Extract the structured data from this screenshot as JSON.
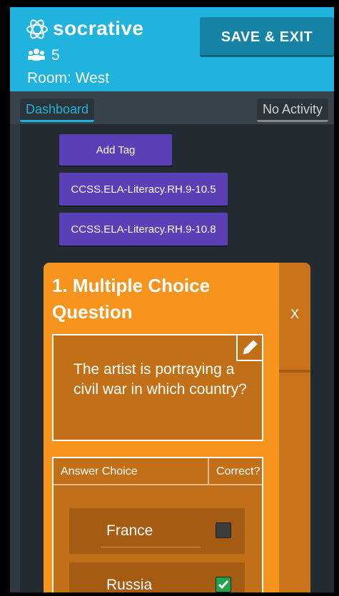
{
  "header": {
    "brand": "socrative",
    "logo_icon": "atom-logo-icon",
    "users_icon": "users-icon",
    "student_count": "5",
    "room": "Room: West",
    "save_exit_label": "SAVE & EXIT",
    "brand_color": "#1fb3dd"
  },
  "subnav": {
    "dashboard_label": "Dashboard",
    "activity_label": "No Activity"
  },
  "tags": {
    "add_tag_label": "Add Tag",
    "items": [
      "CCSS.ELA-Literacy.RH.9-10.5",
      "CCSS.ELA-Literacy.RH.9-10.8"
    ],
    "color": "#5a3fb6"
  },
  "question": {
    "title": "1. Multiple Choice Question",
    "close_label": "X",
    "text": "The artist is portraying a civil war in which country?",
    "edit_icon": "pencil-icon",
    "card_color": "#f7941d",
    "answer_header": "Answer Choice",
    "correct_header": "Correct?",
    "choices": [
      {
        "label": "France",
        "correct": false
      },
      {
        "label": "Russia",
        "correct": true
      }
    ]
  }
}
